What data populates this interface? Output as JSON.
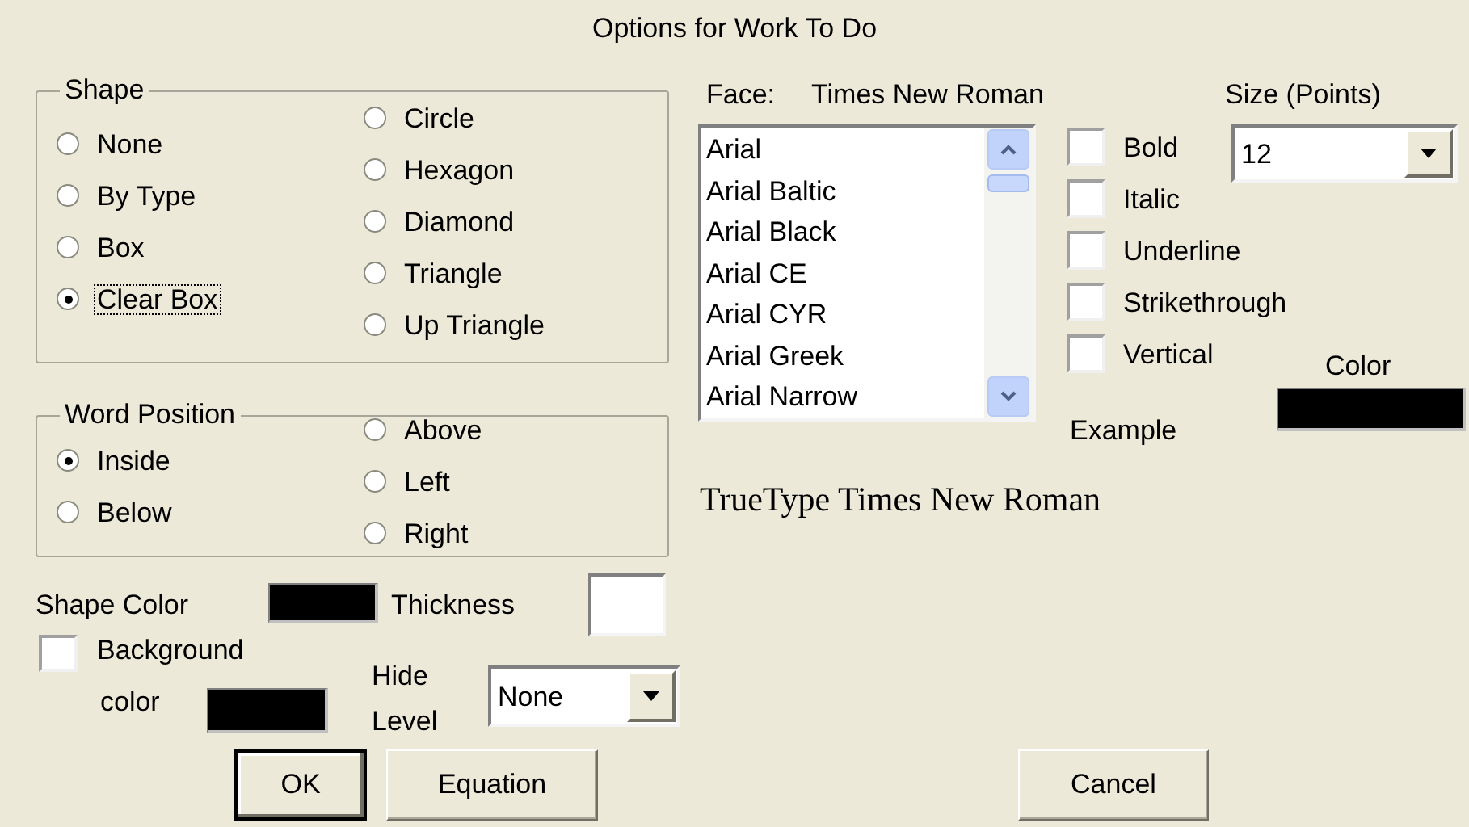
{
  "window": {
    "title": "Options for Work To Do"
  },
  "shape": {
    "legend": "Shape",
    "options": [
      {
        "label": "None",
        "selected": false,
        "focused": false
      },
      {
        "label": "By Type",
        "selected": false,
        "focused": false
      },
      {
        "label": "Box",
        "selected": false,
        "focused": false
      },
      {
        "label": "Clear Box",
        "selected": true,
        "focused": true
      },
      {
        "label": "Circle",
        "selected": false,
        "focused": false
      },
      {
        "label": "Hexagon",
        "selected": false,
        "focused": false
      },
      {
        "label": "Diamond",
        "selected": false,
        "focused": false
      },
      {
        "label": "Triangle",
        "selected": false,
        "focused": false
      },
      {
        "label": "Up Triangle",
        "selected": false,
        "focused": false
      }
    ]
  },
  "word_position": {
    "legend": "Word Position",
    "options": [
      {
        "label": "Inside",
        "selected": true
      },
      {
        "label": "Below",
        "selected": false
      },
      {
        "label": "Above",
        "selected": false
      },
      {
        "label": "Left",
        "selected": false
      },
      {
        "label": "Right",
        "selected": false
      }
    ]
  },
  "shape_color": {
    "label": "Shape Color",
    "color": "#000000"
  },
  "thickness": {
    "label": "Thickness"
  },
  "background": {
    "label_1": "Background",
    "label_2": "color",
    "checked": false,
    "color": "#000000"
  },
  "hide_level": {
    "label_1": "Hide",
    "label_2": "Level",
    "value": "None"
  },
  "face": {
    "label": "Face:",
    "value": "Times New Roman"
  },
  "fonts": [
    "Arial",
    "Arial Baltic",
    "Arial Black",
    "Arial CE",
    "Arial CYR",
    "Arial Greek",
    "Arial Narrow"
  ],
  "styles": [
    {
      "label": "Bold",
      "checked": false
    },
    {
      "label": "Italic",
      "checked": false
    },
    {
      "label": "Underline",
      "checked": false
    },
    {
      "label": "Strikethrough",
      "checked": false
    },
    {
      "label": "Vertical",
      "checked": false
    }
  ],
  "size": {
    "label": "Size (Points)",
    "value": "12"
  },
  "color": {
    "label": "Color",
    "color": "#000000"
  },
  "example": {
    "label": "Example",
    "text": "TrueType Times New Roman"
  },
  "buttons": [
    {
      "label": "OK",
      "kind": "default"
    },
    {
      "label": "Equation",
      "kind": "normal"
    },
    {
      "label": "Cancel",
      "kind": "normal"
    }
  ]
}
